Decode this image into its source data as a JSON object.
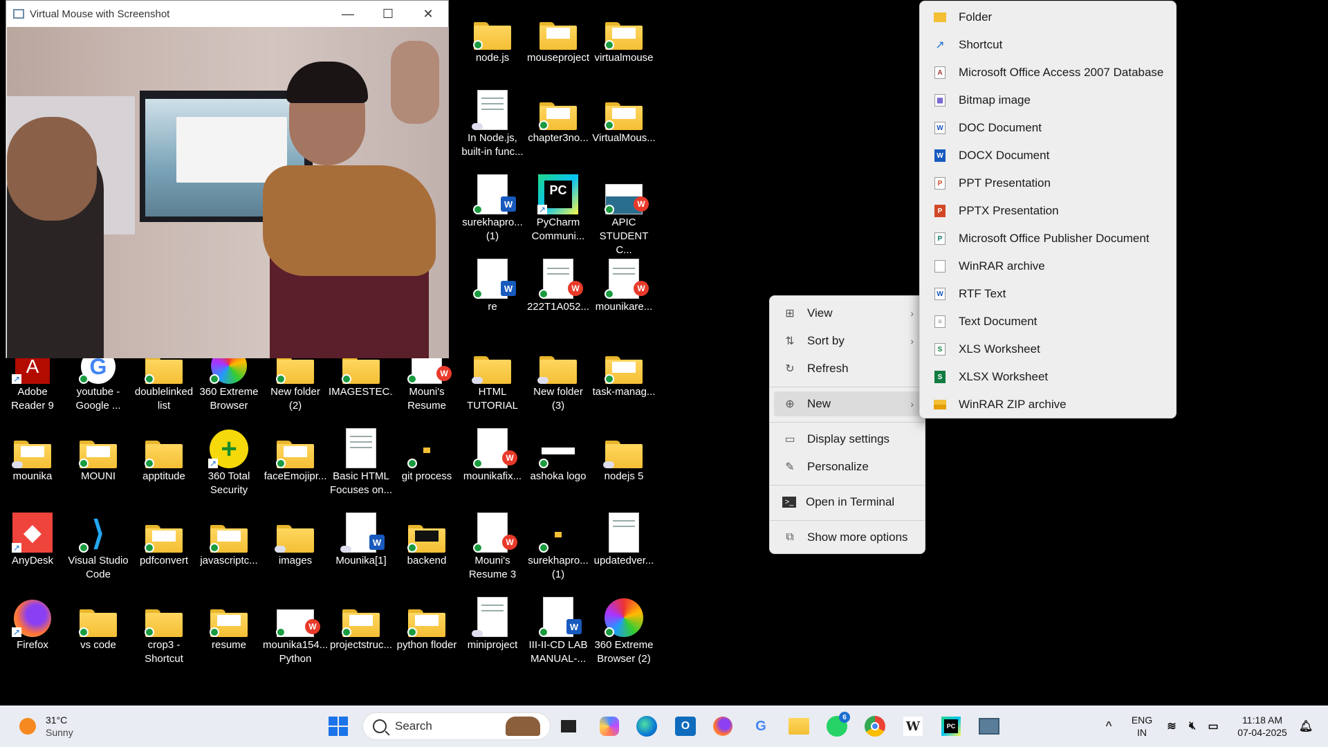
{
  "window": {
    "title": "Virtual Mouse with Screenshot",
    "minimize": "—",
    "maximize": "☐",
    "close": "✕"
  },
  "desktop": {
    "icons": [
      {
        "label": "node.js"
      },
      {
        "label": "mouseproject"
      },
      {
        "label": "virtualmouse"
      },
      {
        "label": "In Node.js,\nbuilt-in func..."
      },
      {
        "label": "chapter3no..."
      },
      {
        "label": "VirtualMous..."
      },
      {
        "label": "surekhapro...\n(1)"
      },
      {
        "label": "PyCharm\nCommuni..."
      },
      {
        "label": "APIC\nSTUDENT C..."
      },
      {
        "label": "re"
      },
      {
        "label": "222T1A052..."
      },
      {
        "label": "mounikare..."
      },
      {
        "label": "Adobe\nReader 9"
      },
      {
        "label": "youtube -\nGoogle ..."
      },
      {
        "label": "doublelinked\nlist"
      },
      {
        "label": "360 Extreme\nBrowser"
      },
      {
        "label": "New folder\n(2)"
      },
      {
        "label": "IMAGESTEC..."
      },
      {
        "label": "Mouni's\nResume"
      },
      {
        "label": "HTML\nTUTORIAL"
      },
      {
        "label": "New folder\n(3)"
      },
      {
        "label": "task-manag..."
      },
      {
        "label": "mounika"
      },
      {
        "label": "MOUNI"
      },
      {
        "label": "apptitude"
      },
      {
        "label": "360 Total\nSecurity"
      },
      {
        "label": "faceEmojipr..."
      },
      {
        "label": "Basic HTML\nFocuses on..."
      },
      {
        "label": "git process"
      },
      {
        "label": "mounikafix..."
      },
      {
        "label": "ashoka logo"
      },
      {
        "label": "nodejs 5"
      },
      {
        "label": "AnyDesk"
      },
      {
        "label": "Visual Studio\nCode"
      },
      {
        "label": "pdfconvert"
      },
      {
        "label": "javascriptc..."
      },
      {
        "label": "images"
      },
      {
        "label": "Mounika[1]"
      },
      {
        "label": "backend"
      },
      {
        "label": "Mouni's\nResume 3"
      },
      {
        "label": "surekhapro...\n(1)"
      },
      {
        "label": "updatedver..."
      },
      {
        "label": "Firefox"
      },
      {
        "label": "vs code"
      },
      {
        "label": "crop3 -\nShortcut"
      },
      {
        "label": "resume"
      },
      {
        "label": "mounika154...\nPython"
      },
      {
        "label": "projectstruc..."
      },
      {
        "label": "python floder"
      },
      {
        "label": "miniproject"
      },
      {
        "label": "III-II-CD LAB\nMANUAL-..."
      },
      {
        "label": "360 Extreme\nBrowser (2)"
      }
    ]
  },
  "context_menu": {
    "items": [
      {
        "label": "View",
        "icon": "grid-icon"
      },
      {
        "label": "Sort by",
        "icon": "sort-icon"
      },
      {
        "label": "Refresh",
        "icon": "refresh-icon"
      },
      {
        "label": "New",
        "icon": "plus-circle-icon"
      },
      {
        "label": "Display settings",
        "icon": "display-icon"
      },
      {
        "label": "Personalize",
        "icon": "brush-icon"
      },
      {
        "label": "Open in Terminal",
        "icon": "terminal-icon"
      },
      {
        "label": "Show more options",
        "icon": "expand-icon"
      }
    ]
  },
  "new_submenu": {
    "items": [
      {
        "label": "Folder"
      },
      {
        "label": "Shortcut"
      },
      {
        "label": "Microsoft Office Access 2007 Database"
      },
      {
        "label": "Bitmap image"
      },
      {
        "label": "DOC Document"
      },
      {
        "label": "DOCX Document"
      },
      {
        "label": "PPT Presentation"
      },
      {
        "label": "PPTX Presentation"
      },
      {
        "label": "Microsoft Office Publisher Document"
      },
      {
        "label": "WinRAR archive"
      },
      {
        "label": "RTF Text"
      },
      {
        "label": "Text Document"
      },
      {
        "label": "XLS Worksheet"
      },
      {
        "label": "XLSX Worksheet"
      },
      {
        "label": "WinRAR ZIP archive"
      }
    ]
  },
  "taskbar": {
    "weather_temp": "31°C",
    "weather_condition": "Sunny",
    "search_placeholder": "Search",
    "whatsapp_badge": "6",
    "lang_top": "ENG",
    "lang_bottom": "IN",
    "time": "11:18 AM",
    "date": "07-04-2025",
    "wps_letter": "W",
    "chevron": "^",
    "google_letter": "G"
  }
}
